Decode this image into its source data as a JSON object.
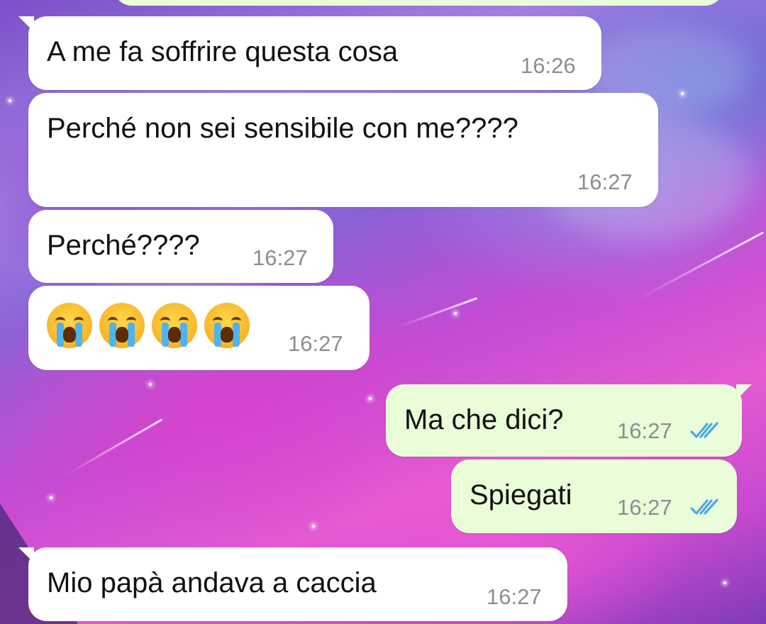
{
  "colors": {
    "incoming_bubble": "#ffffff",
    "outgoing_bubble": "#e8fdd8",
    "time_text": "#8a8f94",
    "read_tick": "#4fa8e6"
  },
  "messages": [
    {
      "direction": "incoming",
      "text": "A me fa soffrire questa cosa",
      "time": "16:26"
    },
    {
      "direction": "incoming",
      "text": "Perché non sei sensibile con me????",
      "time": "16:27"
    },
    {
      "direction": "incoming",
      "text": "Perché????",
      "time": "16:27"
    },
    {
      "direction": "incoming",
      "emoji": [
        "loudly-crying-face",
        "loudly-crying-face",
        "loudly-crying-face",
        "loudly-crying-face"
      ],
      "time": "16:27"
    },
    {
      "direction": "outgoing",
      "text": "Ma che dici?",
      "time": "16:27",
      "status": "read-double-tick-icon"
    },
    {
      "direction": "outgoing",
      "text": "Spiegati",
      "time": "16:27",
      "status": "read-double-tick-icon"
    },
    {
      "direction": "incoming",
      "text": "Mio papà andava a caccia",
      "time": "16:27"
    }
  ]
}
